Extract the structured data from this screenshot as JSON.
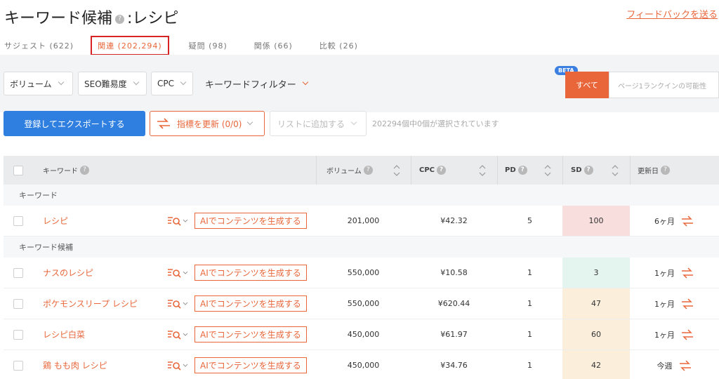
{
  "header": {
    "title": "キーワード候補",
    "query": ":レシピ",
    "help": "?",
    "feedback": "フィードバックを送る"
  },
  "tabs": [
    {
      "label": "サジェスト (622)",
      "active": false
    },
    {
      "label": "関連 (202,294)",
      "active": true
    },
    {
      "label": "疑問 (98)",
      "active": false
    },
    {
      "label": "関係 (66)",
      "active": false
    },
    {
      "label": "比較 (26)",
      "active": false
    }
  ],
  "filters": {
    "volume": "ボリューム",
    "seo": "SEO難易度",
    "cpc": "CPC",
    "keyword_filter": "キーワードフィルター",
    "beta": "BETA",
    "all": "すべて",
    "rank_placeholder": "ページ1ランクインの可能性"
  },
  "actions": {
    "export": "登録してエクスポートする",
    "refresh": "指標を更新 (0/0)",
    "add_list": "リストに追加する",
    "selected": "202294個中0個が選択されています"
  },
  "table": {
    "headers": {
      "keyword": "キーワード",
      "volume": "ボリューム",
      "cpc": "CPC",
      "pd": "PD",
      "sd": "SD",
      "updated": "更新日"
    },
    "group_main": "キーワード",
    "group_candidates": "キーワード候補",
    "ai_label": "AIでコンテンツを生成する",
    "main_row": {
      "keyword": "レシピ",
      "volume": "201,000",
      "cpc": "¥42.32",
      "pd": "5",
      "sd": "100",
      "updated": "6ヶ月"
    },
    "rows": [
      {
        "keyword": "ナスのレシピ",
        "volume": "550,000",
        "cpc": "¥10.58",
        "pd": "1",
        "sd": "3",
        "updated": "1ヶ月"
      },
      {
        "keyword": "ポケモンスリープ レシピ",
        "volume": "550,000",
        "cpc": "¥620.44",
        "pd": "1",
        "sd": "47",
        "updated": "1ヶ月"
      },
      {
        "keyword": "レシピ白菜",
        "volume": "450,000",
        "cpc": "¥61.97",
        "pd": "1",
        "sd": "60",
        "updated": "1ヶ月"
      },
      {
        "keyword": "鶏 もも肉 レシピ",
        "volume": "450,000",
        "cpc": "¥34.76",
        "pd": "1",
        "sd": "42",
        "updated": "今週"
      }
    ]
  },
  "colors": {
    "accent": "#e8663a",
    "primary": "#2f7fe0",
    "sd_high": "#f9dede",
    "sd_low": "#e3f5ee",
    "sd_mid": "#fbefdc"
  }
}
